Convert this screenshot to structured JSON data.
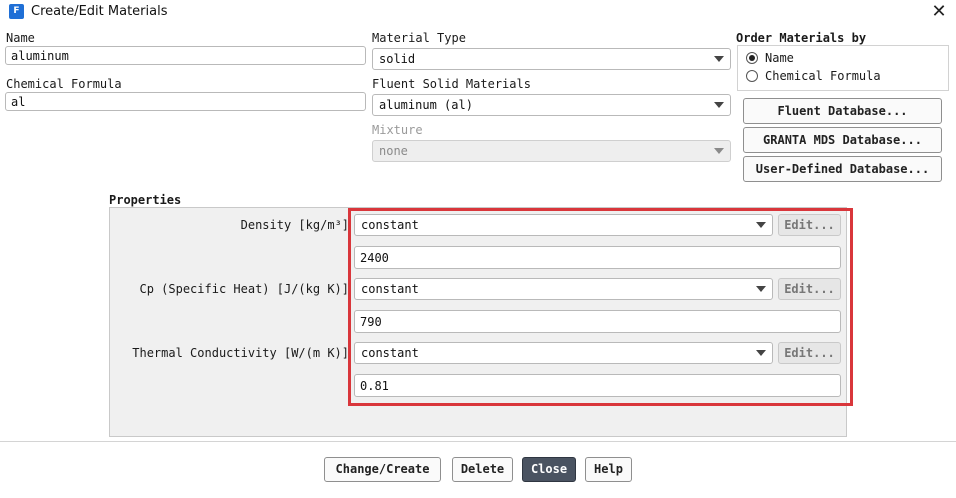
{
  "window": {
    "title": "Create/Edit Materials",
    "app_icon_letter": "F",
    "close_glyph": "✕"
  },
  "name": {
    "label": "Name",
    "value": "aluminum"
  },
  "chemical_formula": {
    "label": "Chemical Formula",
    "value": "al"
  },
  "material_type": {
    "label": "Material Type",
    "value": "solid"
  },
  "fluent_solid_materials": {
    "label": "Fluent Solid Materials",
    "value": "aluminum (al)"
  },
  "mixture": {
    "label": "Mixture",
    "value": "none"
  },
  "order_by": {
    "label": "Order Materials by",
    "options": [
      {
        "label": "Name",
        "checked": true
      },
      {
        "label": "Chemical Formula",
        "checked": false
      }
    ]
  },
  "databases": {
    "fluent": "Fluent Database...",
    "granta": "GRANTA MDS Database...",
    "user_defined": "User-Defined Database..."
  },
  "properties": {
    "label": "Properties",
    "rows": [
      {
        "label": "Density [kg/m³]",
        "method": "constant",
        "edit": "Edit...",
        "value": "2400"
      },
      {
        "label": "Cp (Specific Heat) [J/(kg K)]",
        "method": "constant",
        "edit": "Edit...",
        "value": "790"
      },
      {
        "label": "Thermal Conductivity [W/(m K)]",
        "method": "constant",
        "edit": "Edit...",
        "value": "0.81"
      }
    ]
  },
  "footer": {
    "change_create": "Change/Create",
    "delete": "Delete",
    "close": "Close",
    "help": "Help"
  },
  "colors": {
    "highlight_border": "#d9363b",
    "primary_button": "#4a5361",
    "panel_bg": "#f0f0f0"
  }
}
